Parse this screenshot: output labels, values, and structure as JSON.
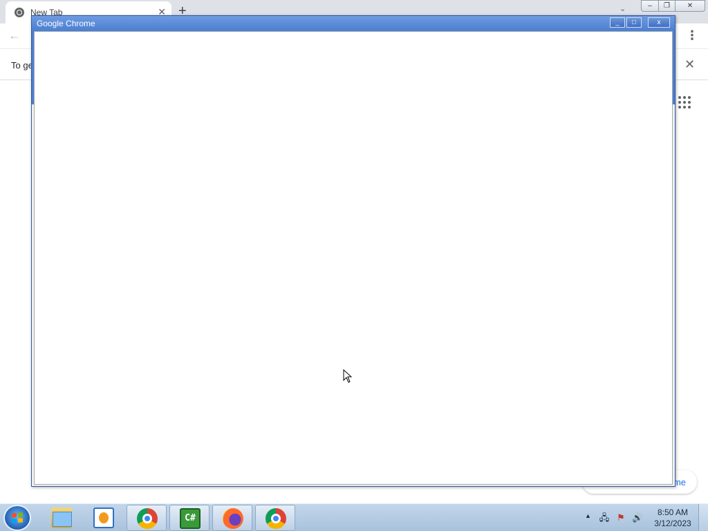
{
  "browser_bg": {
    "tab": {
      "title": "New Tab",
      "close": "✕"
    },
    "new_tab": "+",
    "tab_search": "⌄",
    "window_controls": {
      "minimize": "‒",
      "restore": "❐",
      "close": "✕"
    },
    "back": "←",
    "menu": "⋮",
    "infobar": {
      "text": "To ge",
      "close": "✕"
    },
    "customize_text": "me"
  },
  "foreground_window": {
    "title": "Google Chrome",
    "controls": {
      "minimize": "_",
      "maximize": "□",
      "close": "x"
    }
  },
  "taskbar": {
    "apps": [
      {
        "name": "Windows Explorer",
        "icon": "folder-icon"
      },
      {
        "name": "Windows Media Player",
        "icon": "media-player-icon"
      },
      {
        "name": "Google Chrome (user)",
        "icon": "chrome-user-icon"
      },
      {
        "name": "C# Project",
        "icon": "csharp-icon",
        "label": "C#"
      },
      {
        "name": "Firefox",
        "icon": "firefox-icon"
      },
      {
        "name": "Google Chrome",
        "icon": "chrome-icon"
      }
    ],
    "tray": {
      "show_hidden": "▲",
      "network": "🖧",
      "flag": "⚑",
      "volume": "🔊"
    },
    "clock": {
      "time": "8:50 AM",
      "date": "3/12/2023"
    }
  },
  "colors": {
    "title_blue": "#4d7fcf",
    "taskbar": "#b8cde3",
    "chrome_link": "#1a73e8"
  }
}
